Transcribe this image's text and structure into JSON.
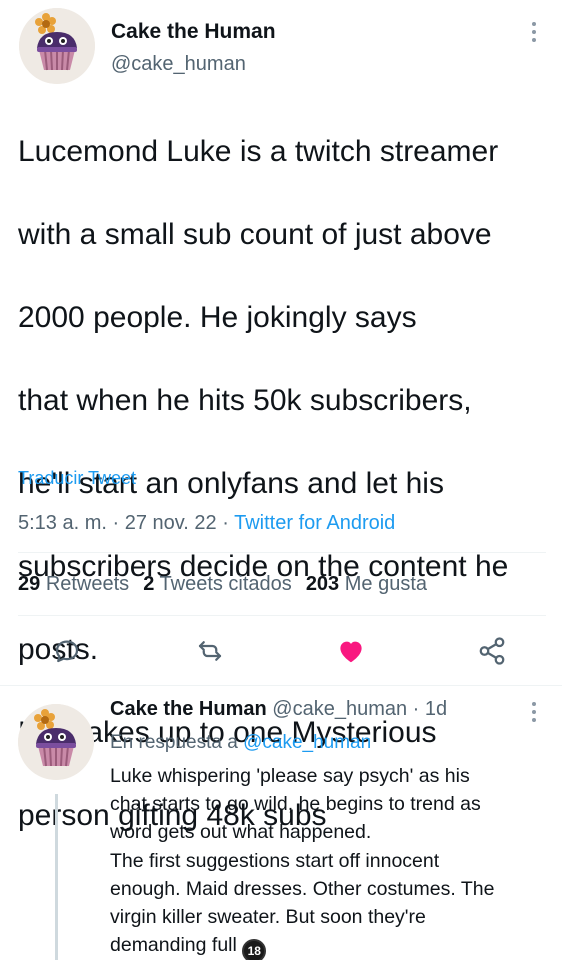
{
  "tweet": {
    "author_name": "Cake the Human",
    "author_handle": "@cake_human",
    "text_lines": [
      "Lucemond Luke is a twitch streamer",
      "with a small sub count of just above",
      "2000 people. He jokingly says",
      "that when he hits 50k subscribers,",
      "he'll start an onlyfans and let his",
      "subscribers decide on the content he",
      "posts.",
      "He wakes up to one Mysterious",
      "person gifting 48k subs"
    ],
    "translate_label": "Traducir Tweet",
    "time": "5:13 a. m.",
    "date": "27 nov. 22",
    "source_app": "Twitter for Android",
    "separator": "·",
    "stats": {
      "retweets_count": "29",
      "retweets_label": "Retweets",
      "quotes_count": "2",
      "quotes_label": "Tweets citados",
      "likes_count": "203",
      "likes_label": "Me gusta"
    },
    "actions": [
      "comment-icon",
      "retweet-icon",
      "heart-filled-icon",
      "share-icon"
    ],
    "like_color": "#f91880"
  },
  "reply": {
    "author_name": "Cake the Human",
    "author_handle": "@cake_human",
    "age": "1d",
    "replying_prefix": "En respuesta a",
    "replying_to": "@cake_human",
    "text_lines": [
      "Luke whispering 'please say psych' as his",
      "chat starts to go wild, he begins to trend as",
      "word gets out what happened.",
      "The first suggestions start off innocent",
      "enough. Maid dresses. Other costumes. The",
      "virgin killer sweater. But soon they're",
      "demanding full"
    ],
    "badge_text": "18"
  },
  "colors": {
    "link": "#1d9bf0",
    "secondary_text": "#536471",
    "primary_text": "#0f1419"
  }
}
